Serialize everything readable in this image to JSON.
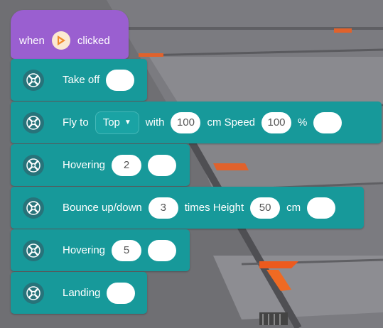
{
  "hat": {
    "when": "when",
    "clicked": "clicked",
    "icon": "play-flag-icon"
  },
  "blocks": [
    {
      "label": "Take off"
    },
    {
      "label": "Fly to",
      "dropdown": "Top",
      "with": "with",
      "distance": "100",
      "unit_cm_speed": "cm Speed",
      "speed": "100",
      "percent": "%"
    },
    {
      "label": "Hovering",
      "value": "2"
    },
    {
      "label": "Bounce up/down",
      "times": "3",
      "times_height": "times Height",
      "height": "50",
      "unit": "cm"
    },
    {
      "label": "Hovering",
      "value": "5"
    },
    {
      "label": "Landing"
    }
  ],
  "colors": {
    "event_block": "#9a5fd0",
    "motion_block": "#17999a",
    "flag": "#f08a2b"
  }
}
